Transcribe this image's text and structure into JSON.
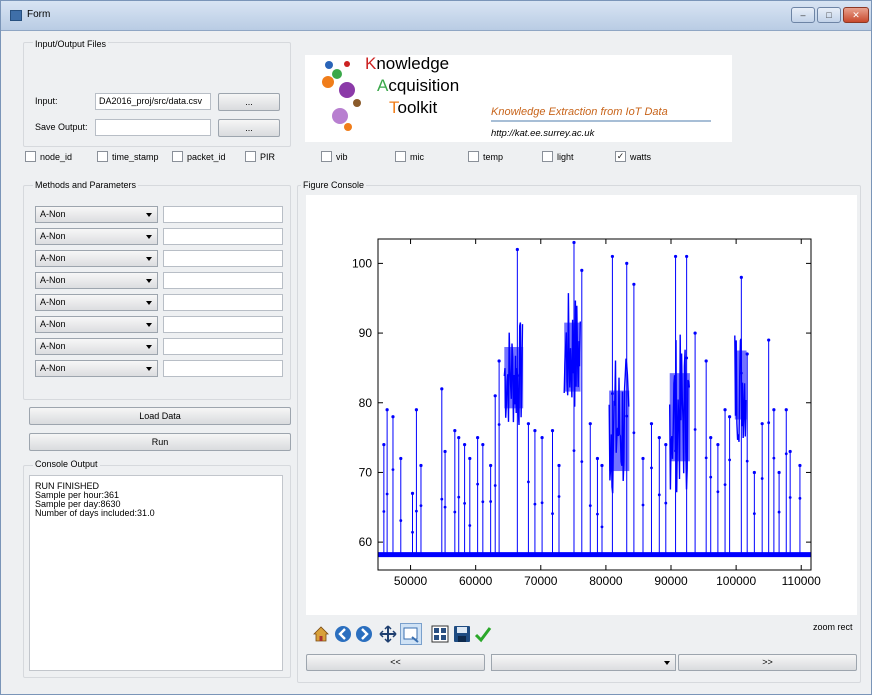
{
  "window": {
    "title": "Form",
    "controls": {
      "minimize": "–",
      "maximize": "□",
      "close": "✕"
    }
  },
  "io_group": {
    "title": "Input/Output Files",
    "input_label": "Input:",
    "input_value": "DA2016_proj/src/data.csv",
    "browse_input_label": "...",
    "save_label": "Save Output:",
    "save_value": "",
    "browse_save_label": "..."
  },
  "logo": {
    "line1": "Knowledge",
    "line2": "Acquisition",
    "line3": "Toolkit",
    "line1_initial": "K",
    "line1_rest": "nowledge",
    "line2_initial": "A",
    "line2_rest": "cquisition",
    "line3_initial": "T",
    "line3_rest": "oolkit",
    "tagline": "Knowledge Extraction from IoT Data",
    "url": "http://kat.ee.surrey.ac.uk",
    "colors": {
      "orange": "#f07d1a",
      "purple": "#8b3aa8",
      "red": "#cc2222",
      "green": "#3aa84a",
      "brown": "#8a5a2a",
      "blue": "#2a64b8",
      "tagline": "#c8641a"
    }
  },
  "columns": [
    {
      "label": "node_id",
      "checked": false
    },
    {
      "label": "time_stamp",
      "checked": false
    },
    {
      "label": "packet_id",
      "checked": false
    },
    {
      "label": "PIR",
      "checked": false
    },
    {
      "label": "vib",
      "checked": false
    },
    {
      "label": "mic",
      "checked": false
    },
    {
      "label": "temp",
      "checked": false
    },
    {
      "label": "light",
      "checked": false
    },
    {
      "label": "watts",
      "checked": true
    }
  ],
  "methods_group": {
    "title": "Methods and Parameters",
    "rows": [
      {
        "method": "A-Non",
        "param": ""
      },
      {
        "method": "A-Non",
        "param": ""
      },
      {
        "method": "A-Non",
        "param": ""
      },
      {
        "method": "A-Non",
        "param": ""
      },
      {
        "method": "A-Non",
        "param": ""
      },
      {
        "method": "A-Non",
        "param": ""
      },
      {
        "method": "A-Non",
        "param": ""
      },
      {
        "method": "A-Non",
        "param": ""
      }
    ]
  },
  "actions": {
    "load_label": "Load Data",
    "run_label": "Run"
  },
  "console": {
    "title": "Console Output",
    "lines": [
      "RUN FINISHED",
      "Sample per hour:361",
      "Sample per day:8630",
      "Number of days included:31.0"
    ]
  },
  "figure": {
    "title": "Figure Console",
    "mode_text": "zoom rect",
    "toolbar_icons": [
      "home-icon",
      "back-icon",
      "forward-icon",
      "pan-icon",
      "zoom-icon",
      "subplots-icon",
      "save-icon",
      "check-icon"
    ],
    "nav_prev": "<<",
    "nav_next": ">>",
    "nav_select": ""
  },
  "chart_data": {
    "type": "line",
    "title": "",
    "xlabel": "",
    "ylabel": "",
    "xlim": [
      45000,
      111500
    ],
    "ylim": [
      56,
      103.5
    ],
    "xticks": [
      50000,
      60000,
      70000,
      80000,
      90000,
      100000,
      110000
    ],
    "yticks": [
      60,
      70,
      80,
      90,
      100
    ],
    "series_color": "#0000ff",
    "baseline": 58.2,
    "spikes": [
      {
        "x": 45900,
        "y": 74
      },
      {
        "x": 46400,
        "y": 79
      },
      {
        "x": 47300,
        "y": 78
      },
      {
        "x": 48500,
        "y": 72
      },
      {
        "x": 50300,
        "y": 67
      },
      {
        "x": 50900,
        "y": 79
      },
      {
        "x": 51600,
        "y": 71
      },
      {
        "x": 54800,
        "y": 82
      },
      {
        "x": 55300,
        "y": 73
      },
      {
        "x": 56800,
        "y": 76
      },
      {
        "x": 57400,
        "y": 75
      },
      {
        "x": 58300,
        "y": 74
      },
      {
        "x": 59100,
        "y": 72
      },
      {
        "x": 60300,
        "y": 75
      },
      {
        "x": 61100,
        "y": 74
      },
      {
        "x": 62300,
        "y": 71
      },
      {
        "x": 63000,
        "y": 81
      },
      {
        "x": 63600,
        "y": 86
      },
      {
        "x": 66400,
        "y": 102
      },
      {
        "x": 68100,
        "y": 77
      },
      {
        "x": 69100,
        "y": 76
      },
      {
        "x": 70200,
        "y": 75
      },
      {
        "x": 71800,
        "y": 76
      },
      {
        "x": 72800,
        "y": 71
      },
      {
        "x": 75100,
        "y": 103
      },
      {
        "x": 76300,
        "y": 99
      },
      {
        "x": 77600,
        "y": 77
      },
      {
        "x": 78700,
        "y": 72
      },
      {
        "x": 79400,
        "y": 71
      },
      {
        "x": 81000,
        "y": 101
      },
      {
        "x": 83200,
        "y": 100
      },
      {
        "x": 84300,
        "y": 97
      },
      {
        "x": 85700,
        "y": 72
      },
      {
        "x": 87000,
        "y": 77
      },
      {
        "x": 88200,
        "y": 75
      },
      {
        "x": 89200,
        "y": 74
      },
      {
        "x": 90700,
        "y": 101
      },
      {
        "x": 92400,
        "y": 101
      },
      {
        "x": 93700,
        "y": 90
      },
      {
        "x": 95400,
        "y": 86
      },
      {
        "x": 96100,
        "y": 75
      },
      {
        "x": 97200,
        "y": 74
      },
      {
        "x": 98300,
        "y": 79
      },
      {
        "x": 99000,
        "y": 78
      },
      {
        "x": 100800,
        "y": 98
      },
      {
        "x": 101700,
        "y": 87
      },
      {
        "x": 102800,
        "y": 70
      },
      {
        "x": 104000,
        "y": 77
      },
      {
        "x": 105000,
        "y": 89
      },
      {
        "x": 105800,
        "y": 79
      },
      {
        "x": 106600,
        "y": 70
      },
      {
        "x": 107700,
        "y": 79
      },
      {
        "x": 108300,
        "y": 73
      },
      {
        "x": 109800,
        "y": 71
      }
    ],
    "dense_segments": [
      {
        "x_start": 64400,
        "x_end": 67300,
        "y_low": 76,
        "y_high": 92
      },
      {
        "x_start": 73600,
        "x_end": 76100,
        "y_low": 78,
        "y_high": 96
      },
      {
        "x_start": 80500,
        "x_end": 83600,
        "y_low": 66,
        "y_high": 87
      },
      {
        "x_start": 89800,
        "x_end": 92900,
        "y_low": 67,
        "y_high": 90
      },
      {
        "x_start": 99800,
        "x_end": 101600,
        "y_low": 74,
        "y_high": 92
      }
    ]
  }
}
